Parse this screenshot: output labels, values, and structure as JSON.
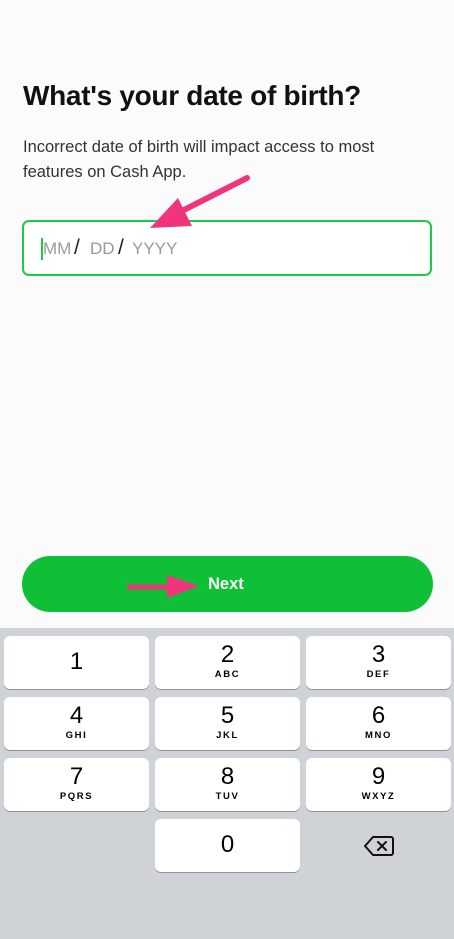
{
  "header": {
    "title": "What's your date of birth?",
    "subtitle": "Incorrect date of birth will impact access to most features on Cash App."
  },
  "dob_input": {
    "month_placeholder": "MM",
    "day_placeholder": "DD",
    "year_placeholder": "YYYY",
    "separator": "/"
  },
  "next_button": {
    "label": "Next"
  },
  "colors": {
    "accent_green": "#0fbf35",
    "field_border": "#1ec94a",
    "annotation_arrow": "#f0357d",
    "keyboard_bg": "#cfd2d7"
  },
  "keypad": {
    "keys": [
      {
        "num": "1",
        "letters": ""
      },
      {
        "num": "2",
        "letters": "ABC"
      },
      {
        "num": "3",
        "letters": "DEF"
      },
      {
        "num": "4",
        "letters": "GHI"
      },
      {
        "num": "5",
        "letters": "JKL"
      },
      {
        "num": "6",
        "letters": "MNO"
      },
      {
        "num": "7",
        "letters": "PQRS"
      },
      {
        "num": "8",
        "letters": "TUV"
      },
      {
        "num": "9",
        "letters": "WXYZ"
      },
      {
        "num": "0",
        "letters": ""
      }
    ],
    "delete_icon": "backspace-icon"
  }
}
